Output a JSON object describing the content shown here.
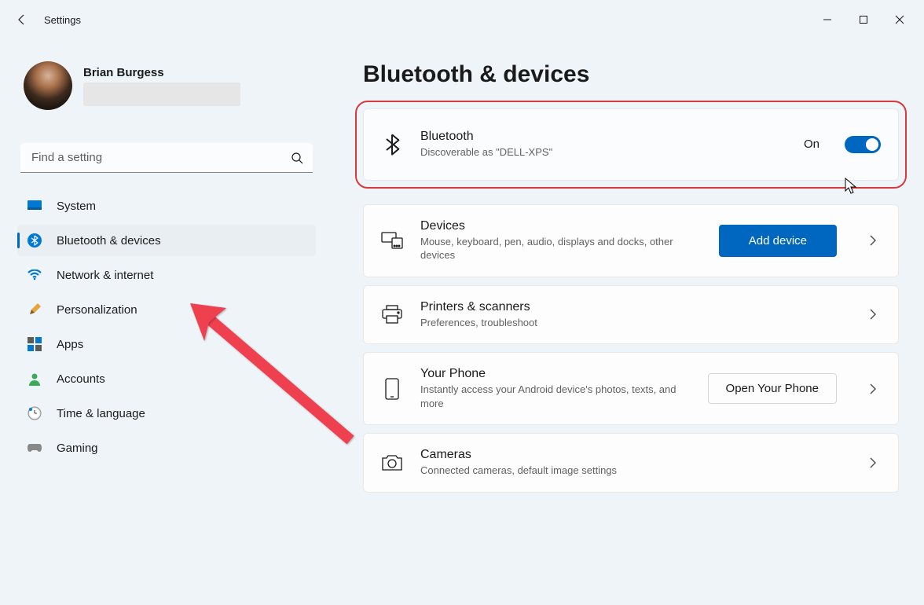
{
  "app": {
    "title": "Settings"
  },
  "user": {
    "name": "Brian Burgess"
  },
  "search": {
    "placeholder": "Find a setting"
  },
  "nav": {
    "items": [
      {
        "id": "system",
        "label": "System"
      },
      {
        "id": "bluetooth",
        "label": "Bluetooth & devices"
      },
      {
        "id": "network",
        "label": "Network & internet"
      },
      {
        "id": "personalization",
        "label": "Personalization"
      },
      {
        "id": "apps",
        "label": "Apps"
      },
      {
        "id": "accounts",
        "label": "Accounts"
      },
      {
        "id": "time",
        "label": "Time & language"
      },
      {
        "id": "gaming",
        "label": "Gaming"
      }
    ]
  },
  "page": {
    "title": "Bluetooth & devices"
  },
  "bluetooth": {
    "title": "Bluetooth",
    "sub": "Discoverable as \"DELL-XPS\"",
    "state_label": "On"
  },
  "cards": {
    "devices": {
      "title": "Devices",
      "sub": "Mouse, keyboard, pen, audio, displays and docks, other devices",
      "action": "Add device"
    },
    "printers": {
      "title": "Printers & scanners",
      "sub": "Preferences, troubleshoot"
    },
    "phone": {
      "title": "Your Phone",
      "sub": "Instantly access your Android device's photos, texts, and more",
      "action": "Open Your Phone"
    },
    "cameras": {
      "title": "Cameras",
      "sub": "Connected cameras, default image settings"
    }
  }
}
